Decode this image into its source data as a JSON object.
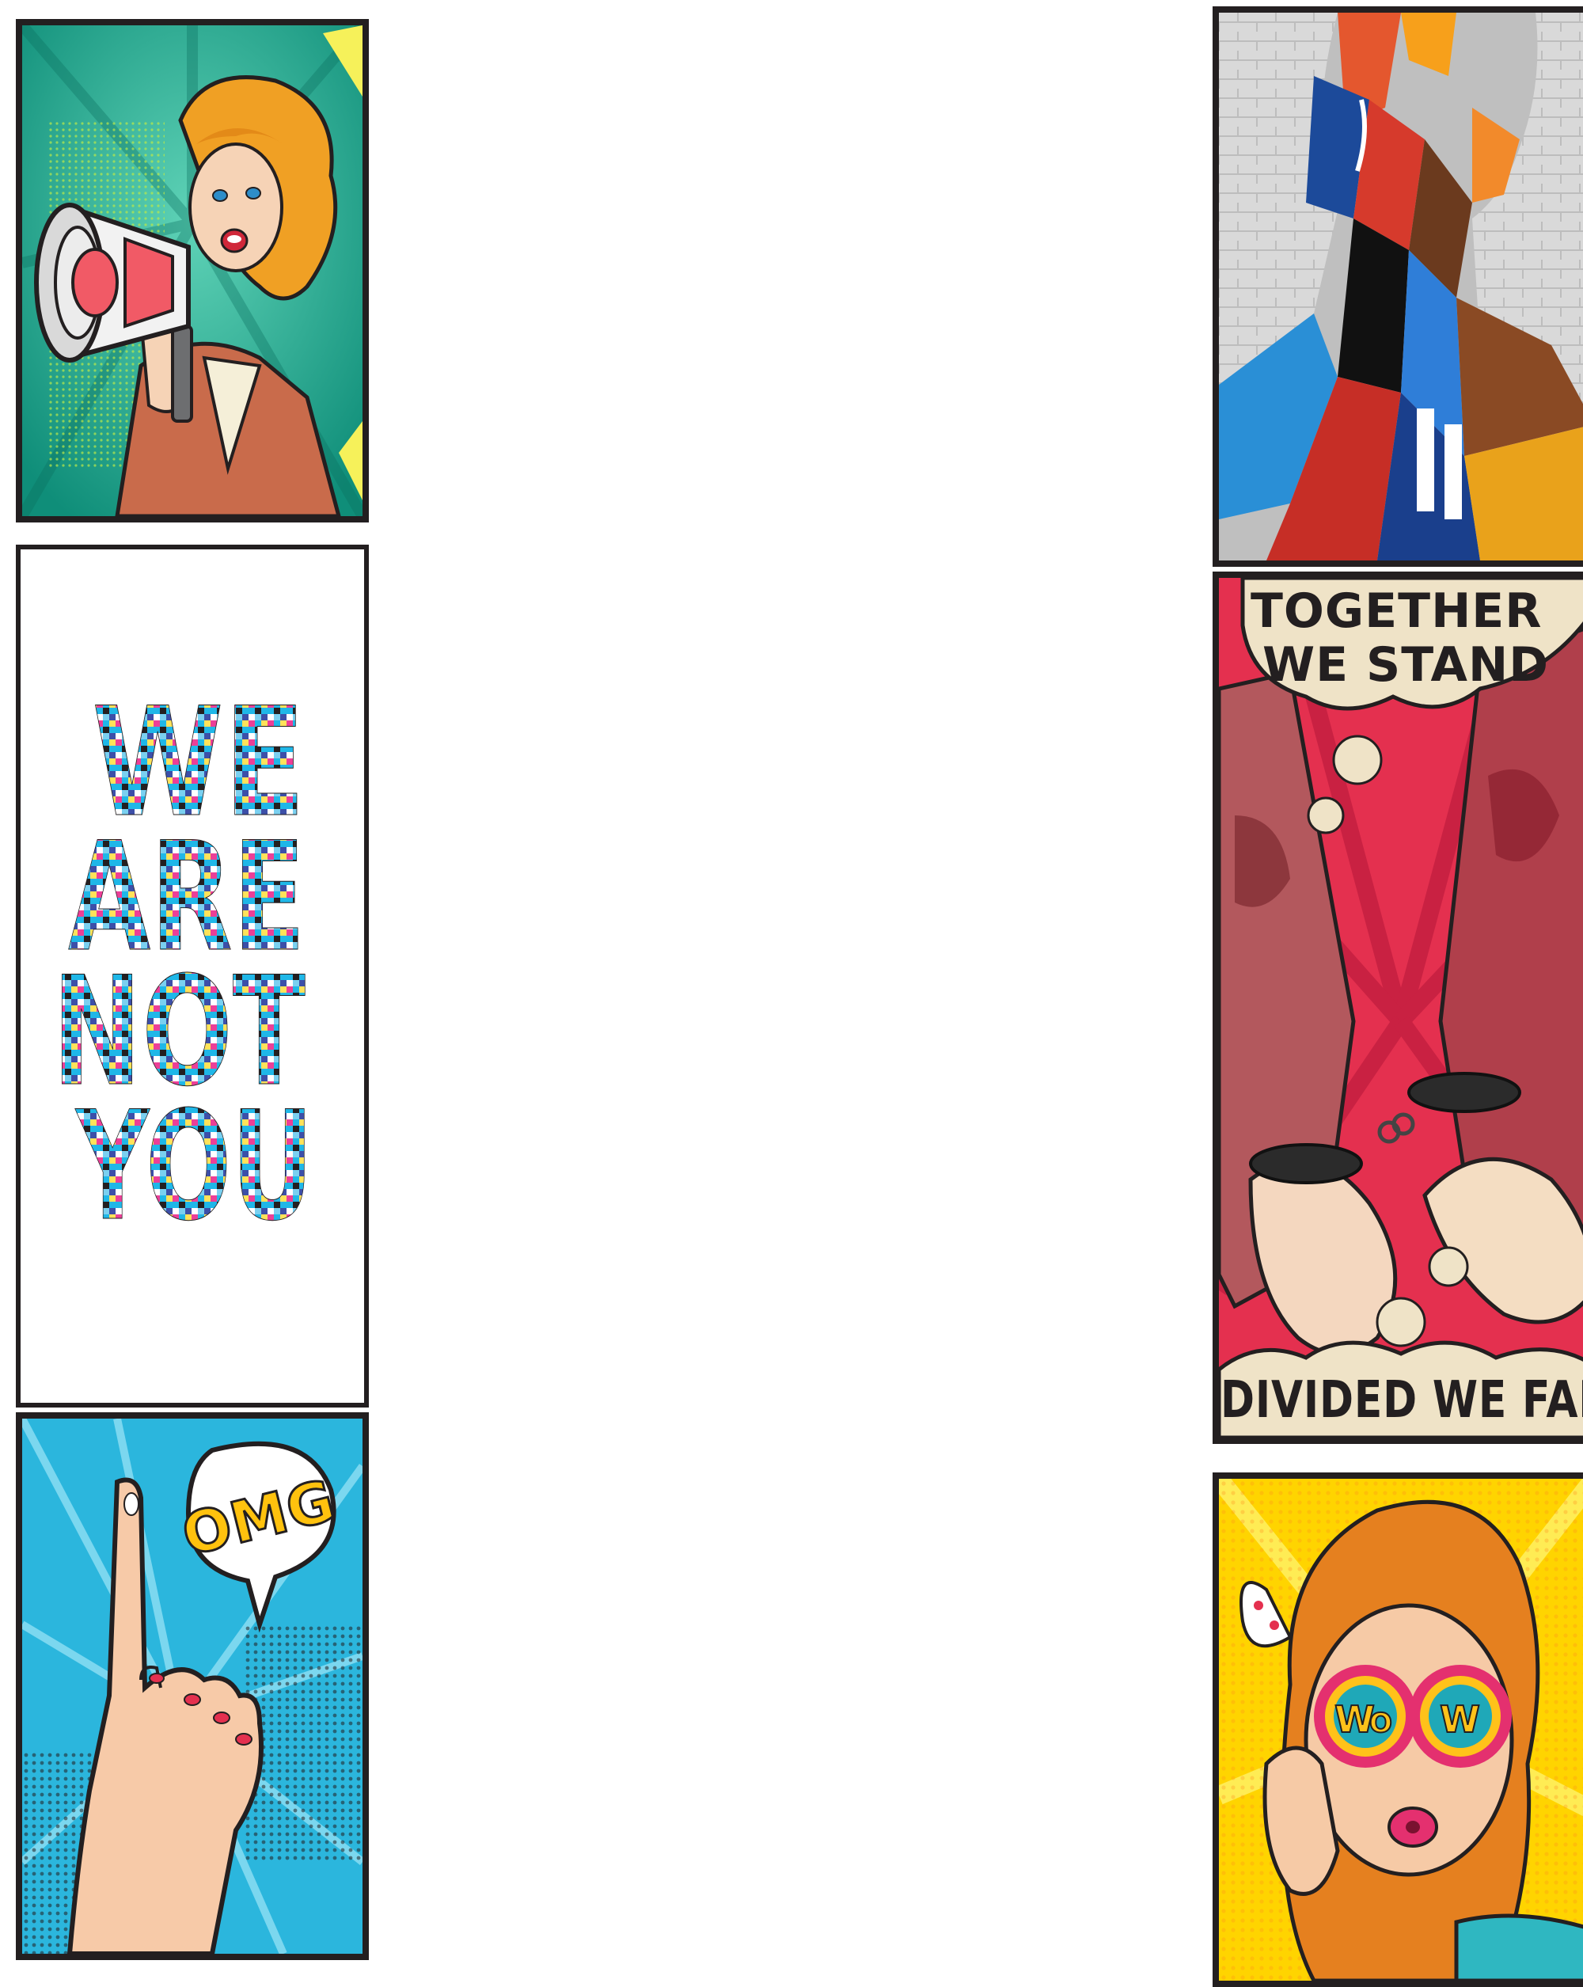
{
  "panels": {
    "megaphone": {
      "subject": "woman-with-megaphone"
    },
    "we_are_not_you": {
      "lines": [
        "WE",
        "ARE",
        "NOT",
        "YOU"
      ]
    },
    "omg": {
      "bubble": "OMG"
    },
    "graffiti": {
      "subject": "street-art-face-mural"
    },
    "together": {
      "top_caption_line1": "TOGETHER",
      "top_caption_line2": "WE STAND",
      "bottom_caption": "DIVIDED WE FALL"
    },
    "wow": {
      "lens_left": "W",
      "lens_left2": "O",
      "lens_right": "W"
    }
  },
  "colors": {
    "frame": "#231f20",
    "teal": "#1aa38a",
    "sky": "#2bb6dd",
    "red": "#e4304f",
    "cream": "#efe3c7",
    "yellow": "#ffd400",
    "skin": "#f4c7a4",
    "hair": "#e58a1f"
  }
}
